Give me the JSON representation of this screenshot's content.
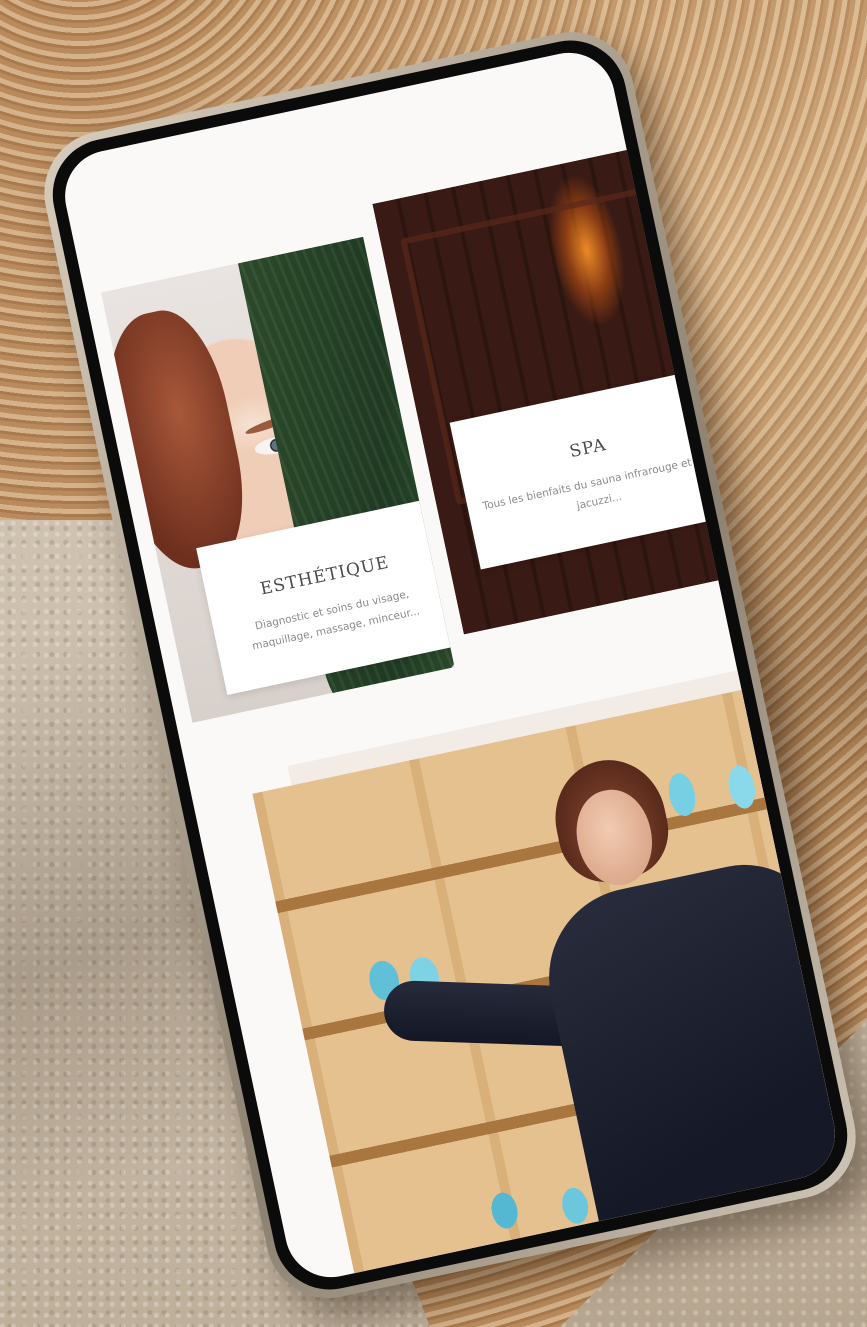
{
  "cards": {
    "esthetique": {
      "title": "ESTHÉTIQUE",
      "description": "Diagnostic et soins du visage, maquillage, massage, minceur..."
    },
    "spa": {
      "title": "SPA",
      "description": "Tous les bienfaits du sauna infrarouge et du jacuzzi..."
    }
  },
  "colors": {
    "screen_background": "#fbf9f8",
    "card_label_background": "#ffffff",
    "title_text": "#4a4a4a",
    "description_text": "#8a8a8a",
    "accent_beige": "#f3ece6"
  }
}
